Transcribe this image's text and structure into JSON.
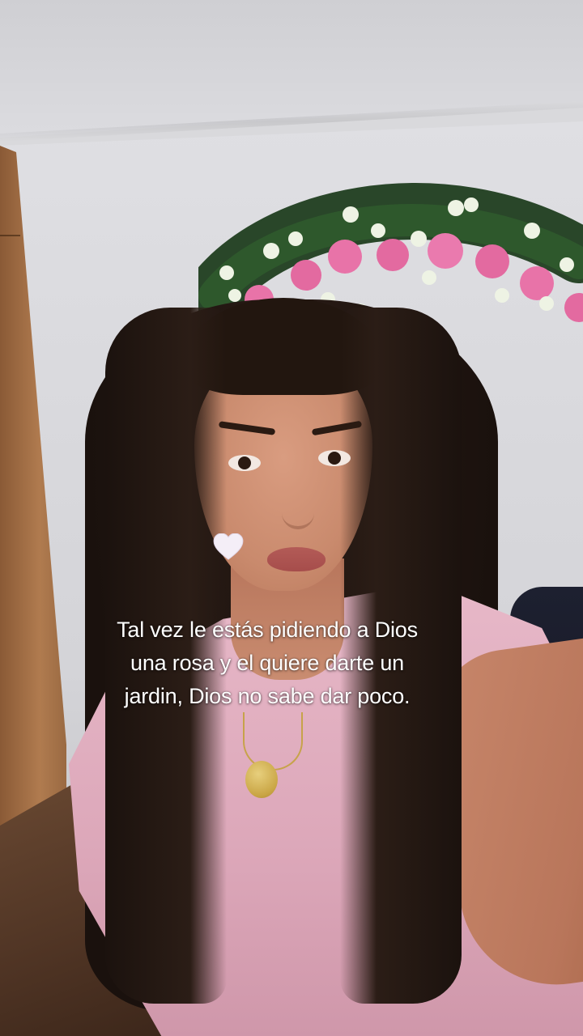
{
  "caption": {
    "line1": "Tal vez le estás pidiendo a Dios",
    "line2": "una rosa y el quiere darte un",
    "line3": "jardin, Dios no sabe dar poco."
  },
  "sticker": {
    "icon": "white-heart-icon",
    "color": "#f4eef7"
  },
  "colors": {
    "shirt": "#e7b8c8",
    "rose": "#e36aa0",
    "wall": "#d9d9dc"
  }
}
